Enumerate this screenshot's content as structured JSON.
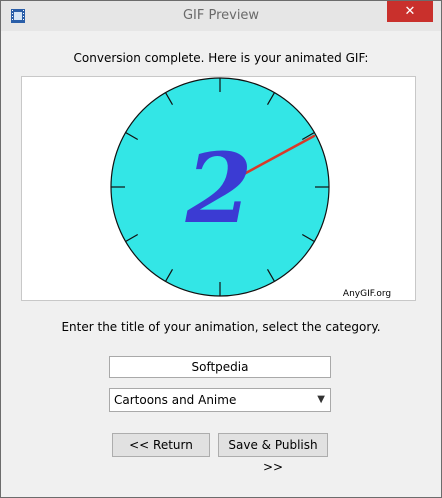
{
  "window": {
    "title": "GIF Preview",
    "close_glyph": "✕"
  },
  "main": {
    "headline": "Conversion complete. Here is your animated GIF:",
    "preview": {
      "watermark": "AnyGIF.org",
      "digit": "2"
    },
    "prompt": "Enter the title of your animation, select the category.",
    "title_value": "Softpedia",
    "category_selected": "Cartoons and Anime",
    "buttons": {
      "return_label": "<<  Return",
      "publish_label": "Save & Publish >>"
    }
  },
  "colors": {
    "clock_face": "#33e6e6",
    "clock_hand": "#d83a2a",
    "digit": "#3b3bd3",
    "close_button": "#c9302c"
  },
  "icons": {
    "app": "film-icon",
    "close": "close-icon",
    "dropdown": "chevron-down-icon"
  }
}
